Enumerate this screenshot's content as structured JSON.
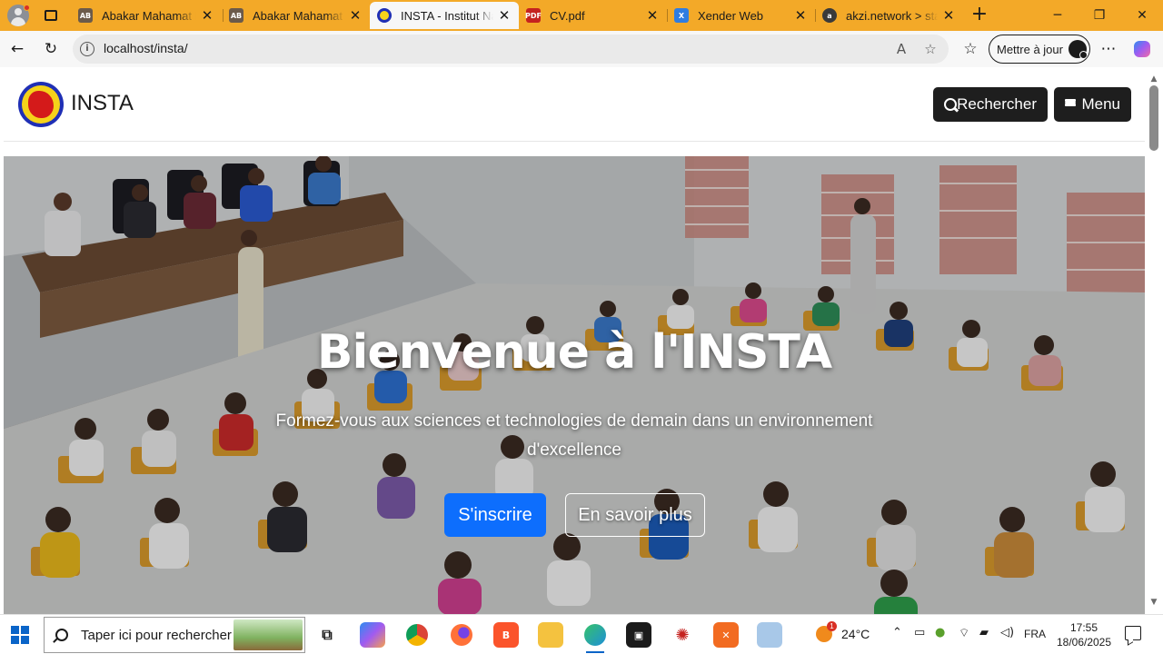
{
  "browser": {
    "tabs": [
      {
        "title": "Abakar Mahamat B",
        "favicon": "ab-avatar",
        "active": false
      },
      {
        "title": "Abakar Mahamat B",
        "favicon": "ab-avatar",
        "active": false
      },
      {
        "title": "INSTA - Institut Nat",
        "favicon": "insta-logo",
        "active": true
      },
      {
        "title": "CV.pdf",
        "favicon": "pdf-icon",
        "active": false
      },
      {
        "title": "Xender Web",
        "favicon": "xender-icon",
        "active": false
      },
      {
        "title": "akzi.network > stati",
        "favicon": "akzi-icon",
        "active": false
      }
    ],
    "url": "localhost/insta/",
    "update_label": "Mettre à jour",
    "accent_color": "#f3a928"
  },
  "site": {
    "brand": "INSTA",
    "search_label": "Rechercher",
    "menu_label": "Menu"
  },
  "hero": {
    "title": "Bienvenue à l'INSTA",
    "subtitle": "Formez-vous aux sciences et technologies de demain dans un environnement d'excellence",
    "primary_button": "S'inscrire",
    "secondary_button": "En savoir plus",
    "primary_color": "#0d6efd"
  },
  "taskbar": {
    "search_placeholder": "Taper ici pour rechercher",
    "weather_temp": "24°C",
    "weather_badge": "1",
    "language": "FRA",
    "time": "17:55",
    "date": "18/06/2025"
  }
}
